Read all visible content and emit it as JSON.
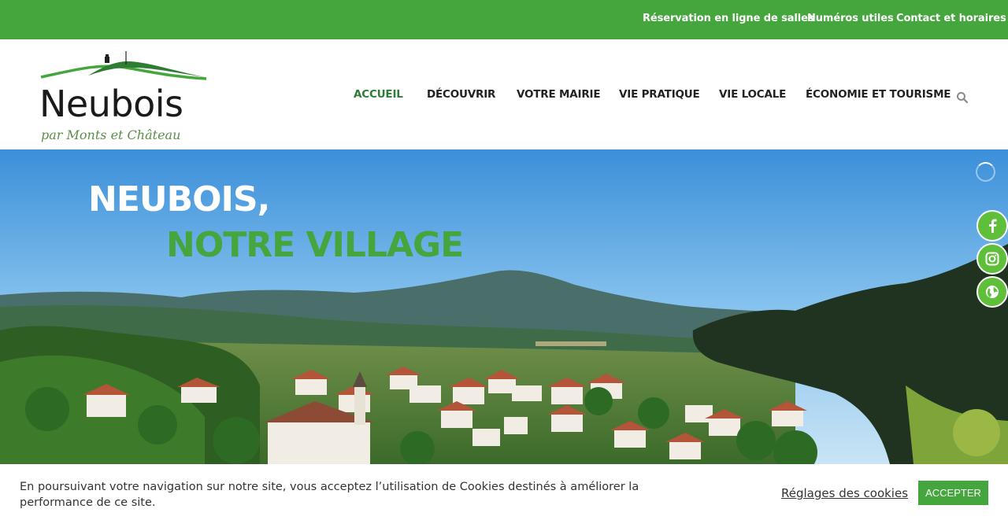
{
  "topbar": {
    "links": [
      "Réservation en ligne de salles",
      "Numéros utiles",
      "Contact et horaires"
    ]
  },
  "logo": {
    "name": "Neubois",
    "tagline": "par Monts et Château"
  },
  "nav": {
    "items": [
      "ACCUEIL",
      "DÉCOUVRIR",
      "VOTRE MAIRIE",
      "VIE PRATIQUE",
      "VIE LOCALE",
      "ÉCONOMIE ET TOURISME"
    ],
    "active": "ACCUEIL",
    "search_icon": "search-icon"
  },
  "hero": {
    "title_line1": "NEUBOIS,",
    "title_line2": "NOTRE VILLAGE"
  },
  "social": [
    "facebook-icon",
    "instagram-icon",
    "globe-icon"
  ],
  "cookie": {
    "text": "En poursuivant votre navigation sur notre site, vous acceptez l’utilisation de Cookies destinés à améliorer la performance de ce site.",
    "settings_label": "Réglages des cookies",
    "accept_label": "ACCEPTER"
  },
  "colors": {
    "brand_green": "#44a63c",
    "dark_green": "#2f7d34",
    "social_green": "#5fbf3a"
  }
}
